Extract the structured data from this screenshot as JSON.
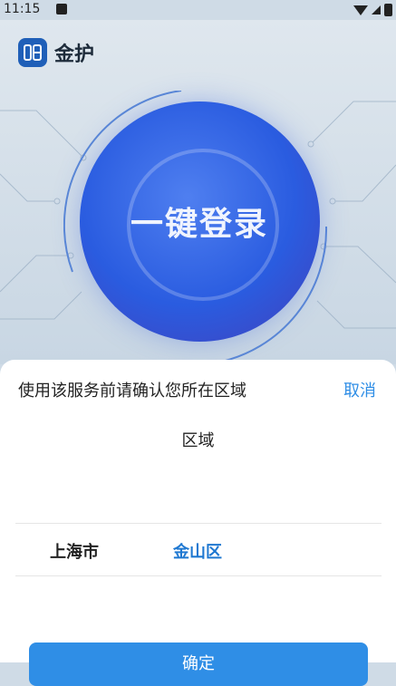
{
  "status_bar": {
    "time": "11:15"
  },
  "app": {
    "name": "金护",
    "logo_icon": "jinhu-logo-icon"
  },
  "hero": {
    "button_text": "一键登录"
  },
  "sheet": {
    "title": "使用该服务前请确认您所在区域",
    "cancel_label": "取消",
    "region_label": "区域",
    "province": "上海市",
    "district": "金山区",
    "confirm_label": "确定"
  },
  "colors": {
    "accent": "#2f8ee6",
    "selected": "#1f78d1",
    "brand": "#1f5fb8"
  }
}
